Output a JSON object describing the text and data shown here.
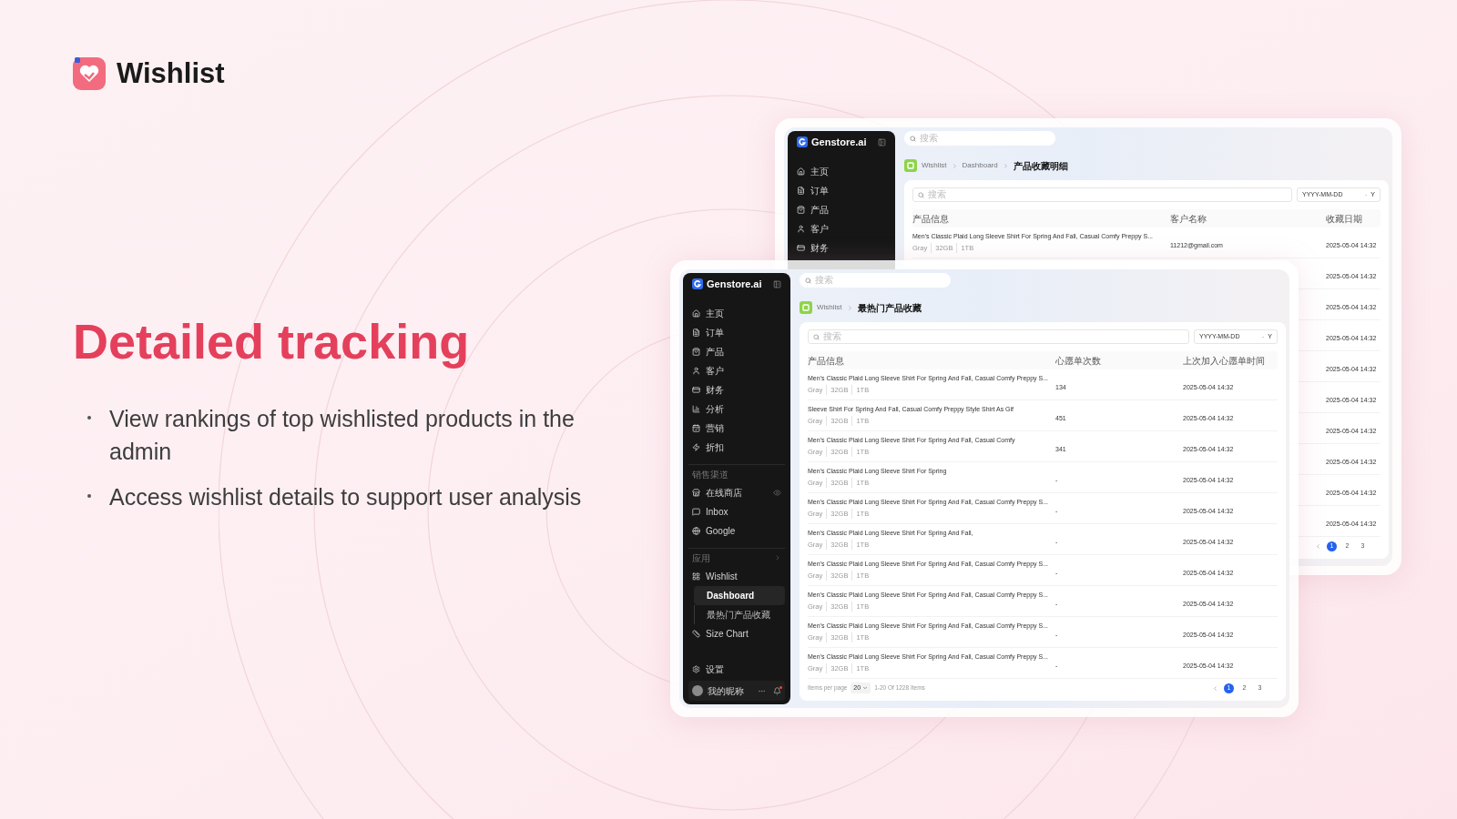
{
  "brand": {
    "name": "Wishlist"
  },
  "headline": "Detailed tracking",
  "bullets": [
    "View rankings of top wishlisted products in the admin",
    "Access wishlist details to support user analysis"
  ],
  "windows": [
    {
      "sidebar": {
        "logo": "Genstore.ai",
        "items": [
          {
            "kind": "item",
            "label": "主页",
            "selected": false
          },
          {
            "kind": "item",
            "label": "订单",
            "selected": false
          },
          {
            "kind": "item",
            "label": "产品",
            "selected": false
          },
          {
            "kind": "item",
            "label": "客户",
            "selected": false
          },
          {
            "kind": "item",
            "label": "财务",
            "selected": false
          }
        ]
      },
      "search": {
        "placeholder": "搜索"
      },
      "breadcrumb": [
        "Wishlist",
        "Dashboard",
        "产品收藏明细"
      ],
      "table": {
        "filter": {
          "placeholder": "搜索",
          "date_start": "YYYY-MM-DD",
          "date_separator": "-",
          "date_end": "Y"
        },
        "columns": [
          "产品信息",
          "客户名称",
          "收藏日期"
        ],
        "rows": [
          {
            "product": "Men’s Classic Plaid Long Sleeve Shirt For Spring And Fall, Casual Comfy Preppy S...",
            "variants": [
              "Gray",
              "32GB",
              "1TB"
            ],
            "value": "11212@gmail.com",
            "date": "2025-05-04 14:32"
          },
          {
            "date": "2025-05-04 14:32"
          },
          {
            "date": "2025-05-04 14:32"
          },
          {
            "date": "2025-05-04 14:32"
          },
          {
            "date": "2025-05-04 14:32"
          },
          {
            "date": "2025-05-04 14:32"
          },
          {
            "date": "2025-05-04 14:32"
          },
          {
            "date": "2025-05-04 14:32"
          },
          {
            "date": "2025-05-04 14:32"
          },
          {
            "date": "2025-05-04 14:32"
          }
        ]
      },
      "pagination": {
        "pages": [
          {
            "label": "1",
            "selected": true
          },
          {
            "label": "2",
            "selected": false
          },
          {
            "label": "3",
            "selected": false
          }
        ]
      }
    },
    {
      "sidebar": {
        "logo": "Genstore.ai",
        "items": [
          {
            "kind": "item",
            "label": "主页",
            "selected": false
          },
          {
            "kind": "item",
            "label": "订单",
            "selected": false
          },
          {
            "kind": "item",
            "label": "产品",
            "selected": false
          },
          {
            "kind": "item",
            "label": "客户",
            "selected": false
          },
          {
            "kind": "item",
            "label": "财务",
            "selected": false
          },
          {
            "kind": "item",
            "label": "分析",
            "selected": false
          },
          {
            "kind": "item",
            "label": "营销",
            "selected": false
          },
          {
            "kind": "item",
            "label": "折扣",
            "selected": false
          },
          {
            "kind": "section",
            "label": "销售渠道"
          },
          {
            "kind": "item",
            "label": "在线商店",
            "selected": false
          },
          {
            "kind": "item",
            "label": "Inbox",
            "selected": false
          },
          {
            "kind": "item",
            "label": "Google",
            "selected": false
          },
          {
            "kind": "section",
            "label": "应用"
          },
          {
            "kind": "item",
            "label": "Wishlist",
            "selected": false,
            "children": [
              {
                "label": "Dashboard",
                "selected": true
              },
              {
                "label": "最热门产品收藏",
                "selected": false
              }
            ]
          },
          {
            "kind": "item",
            "label": "Size Chart",
            "selected": false
          }
        ],
        "footer_items": [
          {
            "label": "设置"
          }
        ],
        "user": {
          "name": "我的昵称",
          "notification": true
        }
      },
      "search": {
        "placeholder": "搜索"
      },
      "breadcrumb": [
        "Wishlist",
        "最热门产品收藏"
      ],
      "table": {
        "filter": {
          "placeholder": "搜索",
          "date_start": "YYYY-MM-DD",
          "date_separator": "-",
          "date_end": "Y"
        },
        "columns": [
          "产品信息",
          "心愿单次数",
          "上次加入心愿单时间"
        ],
        "rows": [
          {
            "product": "Men’s Classic Plaid Long Sleeve Shirt For Spring And Fall, Casual Comfy Preppy S...",
            "variants": [
              "Gray",
              "32GB",
              "1TB"
            ],
            "value": "134",
            "date": "2025-05-04 14:32"
          },
          {
            "product": "Sleeve Shirt For Spring And Fall, Casual Comfy Preppy Style Shirt As Gif",
            "variants": [
              "Gray",
              "32GB",
              "1TB"
            ],
            "value": "451",
            "date": "2025-05-04 14:32"
          },
          {
            "product": "Men’s Classic Plaid Long Sleeve Shirt For Spring And Fall, Casual Comfy",
            "variants": [
              "Gray",
              "32GB",
              "1TB"
            ],
            "value": "341",
            "date": "2025-05-04 14:32"
          },
          {
            "product": "Men’s Classic Plaid Long Sleeve Shirt For Spring",
            "variants": [
              "Gray",
              "32GB",
              "1TB"
            ],
            "value": "-",
            "date": "2025-05-04 14:32"
          },
          {
            "product": "Men’s Classic Plaid Long Sleeve Shirt For Spring And Fall, Casual Comfy Preppy S...",
            "variants": [
              "Gray",
              "32GB",
              "1TB"
            ],
            "value": "-",
            "date": "2025-05-04 14:32"
          },
          {
            "product": "Men’s Classic Plaid Long Sleeve Shirt For Spring And Fall,",
            "variants": [
              "Gray",
              "32GB",
              "1TB"
            ],
            "value": "-",
            "date": "2025-05-04 14:32"
          },
          {
            "product": "Men’s Classic Plaid Long Sleeve Shirt For Spring And Fall, Casual Comfy Preppy S...",
            "variants": [
              "Gray",
              "32GB",
              "1TB"
            ],
            "value": "-",
            "date": "2025-05-04 14:32"
          },
          {
            "product": "Men’s Classic Plaid Long Sleeve Shirt For Spring And Fall, Casual Comfy Preppy S...",
            "variants": [
              "Gray",
              "32GB",
              "1TB"
            ],
            "value": "-",
            "date": "2025-05-04 14:32"
          },
          {
            "product": "Men’s Classic Plaid Long Sleeve Shirt For Spring And Fall, Casual Comfy Preppy S...",
            "variants": [
              "Gray",
              "32GB",
              "1TB"
            ],
            "value": "-",
            "date": "2025-05-04 14:32"
          },
          {
            "product": "Men’s Classic Plaid Long Sleeve Shirt For Spring And Fall, Casual Comfy Preppy S...",
            "variants": [
              "Gray",
              "32GB",
              "1TB"
            ],
            "value": "-",
            "date": "2025-05-04 14:32"
          }
        ]
      },
      "pagination": {
        "per_page_label": "Items per page",
        "per_page": "20",
        "range": "1-20 Of 1228 Items",
        "pages": [
          {
            "label": "1",
            "selected": true
          },
          {
            "label": "2",
            "selected": false
          },
          {
            "label": "3",
            "selected": false
          }
        ]
      }
    }
  ]
}
